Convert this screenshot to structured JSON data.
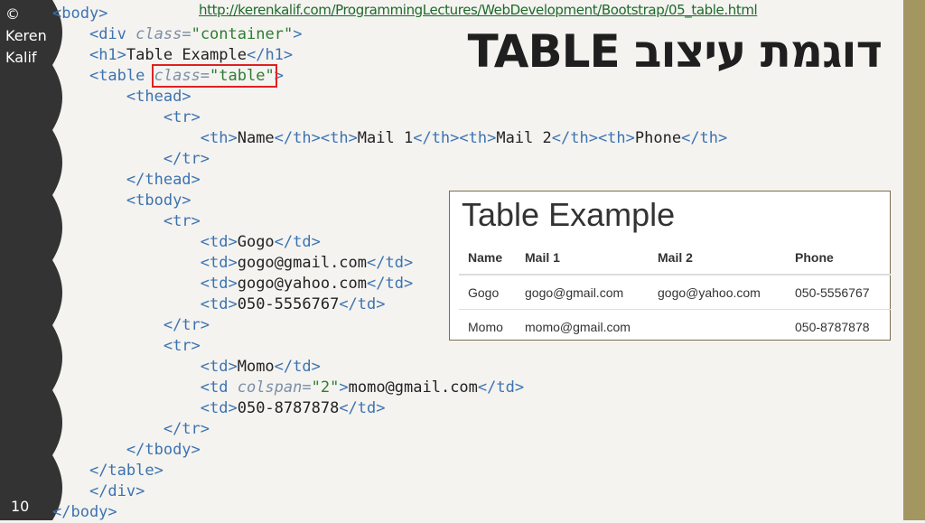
{
  "author": {
    "copyright": "©",
    "first": "Keren",
    "last": "Kalif"
  },
  "slide_number": "10",
  "url": "http://kerenkalif.com/ProgrammingLectures/WebDevelopment/Bootstrap/05_table.html",
  "title": "דוגמת עיצוב TABLE",
  "code": {
    "container_class": "container",
    "h1_text": "Table Example",
    "table_class": "table",
    "headers": [
      "Name",
      "Mail 1",
      "Mail 2",
      "Phone"
    ],
    "row1": [
      "Gogo",
      "gogo@gmail.com",
      "gogo@yahoo.com",
      "050-5556767"
    ],
    "row2_name": "Momo",
    "row2_colspan": "2",
    "row2_mail": "momo@gmail.com",
    "row2_phone": "050-8787878"
  },
  "preview": {
    "heading": "Table Example",
    "headers": [
      "Name",
      "Mail 1",
      "Mail 2",
      "Phone"
    ],
    "rows": [
      [
        "Gogo",
        "gogo@gmail.com",
        "gogo@yahoo.com",
        "050-5556767"
      ],
      [
        "Momo",
        "momo@gmail.com",
        "",
        "050-8787878"
      ]
    ]
  },
  "colors": {
    "left_band": "#333333",
    "right_band": "#a39661",
    "highlight": "#e02020"
  }
}
